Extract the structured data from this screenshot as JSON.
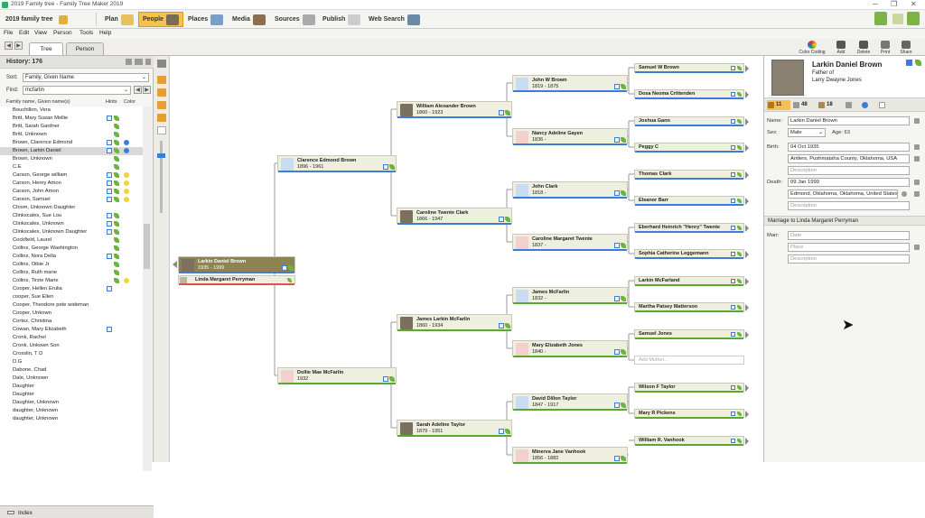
{
  "window": {
    "title": "2019 Family tree - Family Tree Maker 2019"
  },
  "toolbar": {
    "tree_name": "2019 family tree",
    "tabs": [
      {
        "label": "Plan"
      },
      {
        "label": "People"
      },
      {
        "label": "Places"
      },
      {
        "label": "Media"
      },
      {
        "label": "Sources"
      },
      {
        "label": "Publish"
      },
      {
        "label": "Web Search"
      }
    ]
  },
  "menu": [
    "File",
    "Edit",
    "View",
    "Person",
    "Tools",
    "Help"
  ],
  "subtabs": {
    "tree": "Tree",
    "person": "Person"
  },
  "right_tools": [
    "Color Coding",
    "Add",
    "Delete",
    "Print",
    "Share"
  ],
  "left": {
    "history": "History: 176",
    "sort_label": "Sort:",
    "sort_value": "Family, Given Name",
    "find_label": "Find:",
    "find_value": "mcfarlin",
    "col_name": "Family name, Given name(s)",
    "col_hints": "Hints",
    "col_color": "Color",
    "people": [
      {
        "name": "Bouchillon, Vera"
      },
      {
        "name": "Britt, Mary Susan Mollie",
        "hint": true,
        "leaf": true
      },
      {
        "name": "Britt, Sarah Gardner",
        "leaf": true
      },
      {
        "name": "Britt, Unknown",
        "leaf": true
      },
      {
        "name": "Brown, Clarence Edmond",
        "hint": true,
        "leaf": true,
        "color": "#3b7dd8"
      },
      {
        "name": "Brown, Larkin Daniel",
        "hint": true,
        "leaf": true,
        "color": "#3b7dd8",
        "selected": true
      },
      {
        "name": "Brown, Unknown",
        "leaf": true
      },
      {
        "name": "C.E",
        "leaf": true
      },
      {
        "name": "Carson, George william",
        "hint": true,
        "leaf": true,
        "color": "#f1d33a"
      },
      {
        "name": "Carson, Henry Amon",
        "hint": true,
        "leaf": true,
        "color": "#f1d33a"
      },
      {
        "name": "Carson, John Amon",
        "hint": true,
        "leaf": true,
        "color": "#f1d33a"
      },
      {
        "name": "Carson, Samuel",
        "hint": true,
        "leaf": true,
        "color": "#f1d33a"
      },
      {
        "name": "Chism, Unknown Daughter"
      },
      {
        "name": "Clinkscales, Sue Lou",
        "hint": true,
        "leaf": true
      },
      {
        "name": "Clinkscales, Unknown",
        "hint": true,
        "leaf": true
      },
      {
        "name": "Clinkscales, Unknown Daughter",
        "hint": true,
        "leaf": true
      },
      {
        "name": "Cockfield, Laurel",
        "leaf": true
      },
      {
        "name": "Collins, George Washington",
        "leaf": true
      },
      {
        "name": "Collins, Nora Della",
        "hint": true,
        "leaf": true
      },
      {
        "name": "Collins, Oibie Jr",
        "leaf": true
      },
      {
        "name": "Collins, Ruth marie",
        "leaf": true
      },
      {
        "name": "Collins, Tirzie Marie",
        "leaf": true,
        "color": "#f1d33a"
      },
      {
        "name": "Cooper, Hellen Erulia",
        "hint": true
      },
      {
        "name": "cooper, Sue Ellen"
      },
      {
        "name": "Cooper, Theodore pete wideman"
      },
      {
        "name": "Cooper, Unkown"
      },
      {
        "name": "Cortez, Christina"
      },
      {
        "name": "Cowan, Mary Elizabeth",
        "hint": true
      },
      {
        "name": "Cronk, Rachel"
      },
      {
        "name": "Cronk, Unkown Son"
      },
      {
        "name": "Crosslin, T D"
      },
      {
        "name": "D.G"
      },
      {
        "name": "Dabone, Chad"
      },
      {
        "name": "Dale, Unknown"
      },
      {
        "name": "Daughter"
      },
      {
        "name": "Daughter"
      },
      {
        "name": "Daughter, Unknown"
      },
      {
        "name": "daughter, Unknown"
      },
      {
        "name": "daughter, Unknown"
      }
    ],
    "index": "Index"
  },
  "tree": {
    "root": {
      "name": "Larkin Daniel Brown",
      "dates": "1935 - 1999"
    },
    "spouse": "Linda Margaret Perryman",
    "gen1": [
      {
        "name": "Clarence Edmond Brown",
        "dates": "1896 - 1961",
        "g": "m"
      },
      {
        "name": "Dollie Mae McFarlin",
        "dates": "1932",
        "g": "f"
      }
    ],
    "gen2": [
      {
        "name": "William Alexander Brown",
        "dates": "1860 - 1923",
        "g": "m",
        "photo": true
      },
      {
        "name": "Caroline Twente Clark",
        "dates": "1866 - 1947",
        "g": "f",
        "photo": true
      },
      {
        "name": "James Larkin McFarlin",
        "dates": "1860 - 1934",
        "g": "m",
        "photo": true
      },
      {
        "name": "Sarah Adeline Taylor",
        "dates": "1879 - 1951",
        "g": "f",
        "photo": true
      }
    ],
    "gen3": [
      {
        "name": "John W Brown",
        "dates": "1819 - 1875",
        "g": "m"
      },
      {
        "name": "Nancy Adeline Gayen",
        "dates": "1836 -",
        "g": "f"
      },
      {
        "name": "John Clark",
        "dates": "1818 -",
        "g": "m"
      },
      {
        "name": "Caroline Margaret Twente",
        "dates": "1837 -",
        "g": "f"
      },
      {
        "name": "James McFarlin",
        "dates": "1832 -",
        "g": "m"
      },
      {
        "name": "Mary Elizabeth Jones",
        "dates": "1840 -",
        "g": "f"
      },
      {
        "name": "David Dillon Taylor",
        "dates": "1847 - 1917",
        "g": "m"
      },
      {
        "name": "Minerva Jane Vanhook",
        "dates": "1856 - 1882",
        "g": "f"
      }
    ],
    "gen4": [
      {
        "name": "Samuel W Brown",
        "g": "m"
      },
      {
        "name": "Dosa Neoma Crittenden",
        "g": "f"
      },
      {
        "name": "Joshua Gann",
        "g": "m"
      },
      {
        "name": "Peggy C",
        "g": "f"
      },
      {
        "name": "Thomas Clark",
        "g": "m"
      },
      {
        "name": "Eleanor Barr",
        "g": "f"
      },
      {
        "name": "Eberhard Heinrich \"Henry\" Twente",
        "g": "m"
      },
      {
        "name": "Sophia Catherine Leggemann",
        "g": "f"
      },
      {
        "name": "Larkin McFarland",
        "g": "m"
      },
      {
        "name": "Martha Patsey Matterson",
        "g": "f"
      },
      {
        "name": "Samuel Jones",
        "g": "m"
      },
      {
        "name": "Add Mother...",
        "g": "ghost"
      },
      {
        "name": "Wilson F Taylor",
        "g": "m"
      },
      {
        "name": "Mary R Pickens",
        "g": "f"
      },
      {
        "name": "William R. Vanhook",
        "g": "m"
      }
    ]
  },
  "right": {
    "name": "Larkin Daniel Brown",
    "rel1": "Father of",
    "rel2": "Larry Dwayne Jones",
    "tab_counts": [
      "11",
      "48",
      "18"
    ],
    "name_label": "Name:",
    "name_value": "Larkin Daniel Brown",
    "sex_label": "Sex:",
    "sex_value": "Male",
    "age": "Age: 63",
    "birth_label": "Birth:",
    "birth_date": "04 Oct 1935",
    "birth_place": "Antlers, Pushmataha County, Oklahoma, USA",
    "birth_desc": "Description",
    "death_label": "Death:",
    "death_date": "09 Jan 1999",
    "death_place": "Edmond, Oklahoma, Oklahoma, United States",
    "death_desc": "Description",
    "marriage_hdr": "Marriage to Linda Margaret Perryman",
    "marr_label": "Marr:",
    "marr_date": "Date",
    "marr_place": "Place",
    "marr_desc": "Description"
  },
  "colors": {
    "male": "#3b7dd8",
    "female": "#d9534f",
    "paternal": "#3b7dd8",
    "maternal": "#5aa832",
    "accent": "#f5c150"
  }
}
